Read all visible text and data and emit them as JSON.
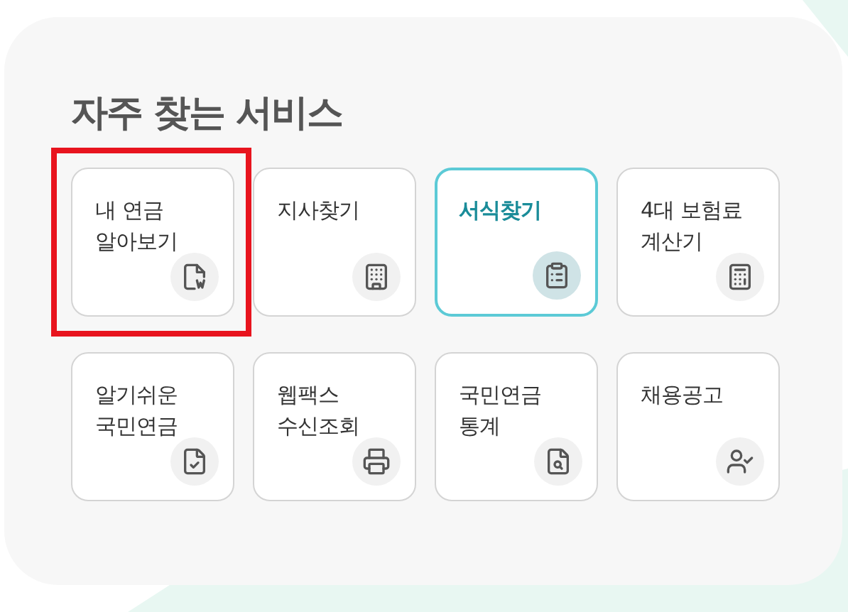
{
  "title": "자주 찾는 서비스",
  "services": [
    {
      "label": "내 연금\n알아보기",
      "selected": false,
      "highlighted": true
    },
    {
      "label": "지사찾기",
      "selected": false,
      "highlighted": false
    },
    {
      "label": "서식찾기",
      "selected": true,
      "highlighted": false
    },
    {
      "label": "4대 보험료\n계산기",
      "selected": false,
      "highlighted": false
    },
    {
      "label": "알기쉬운\n국민연금",
      "selected": false,
      "highlighted": false
    },
    {
      "label": "웹팩스\n수신조회",
      "selected": false,
      "highlighted": false
    },
    {
      "label": "국민연금\n통계",
      "selected": false,
      "highlighted": false
    },
    {
      "label": "채용공고",
      "selected": false,
      "highlighted": false
    }
  ]
}
